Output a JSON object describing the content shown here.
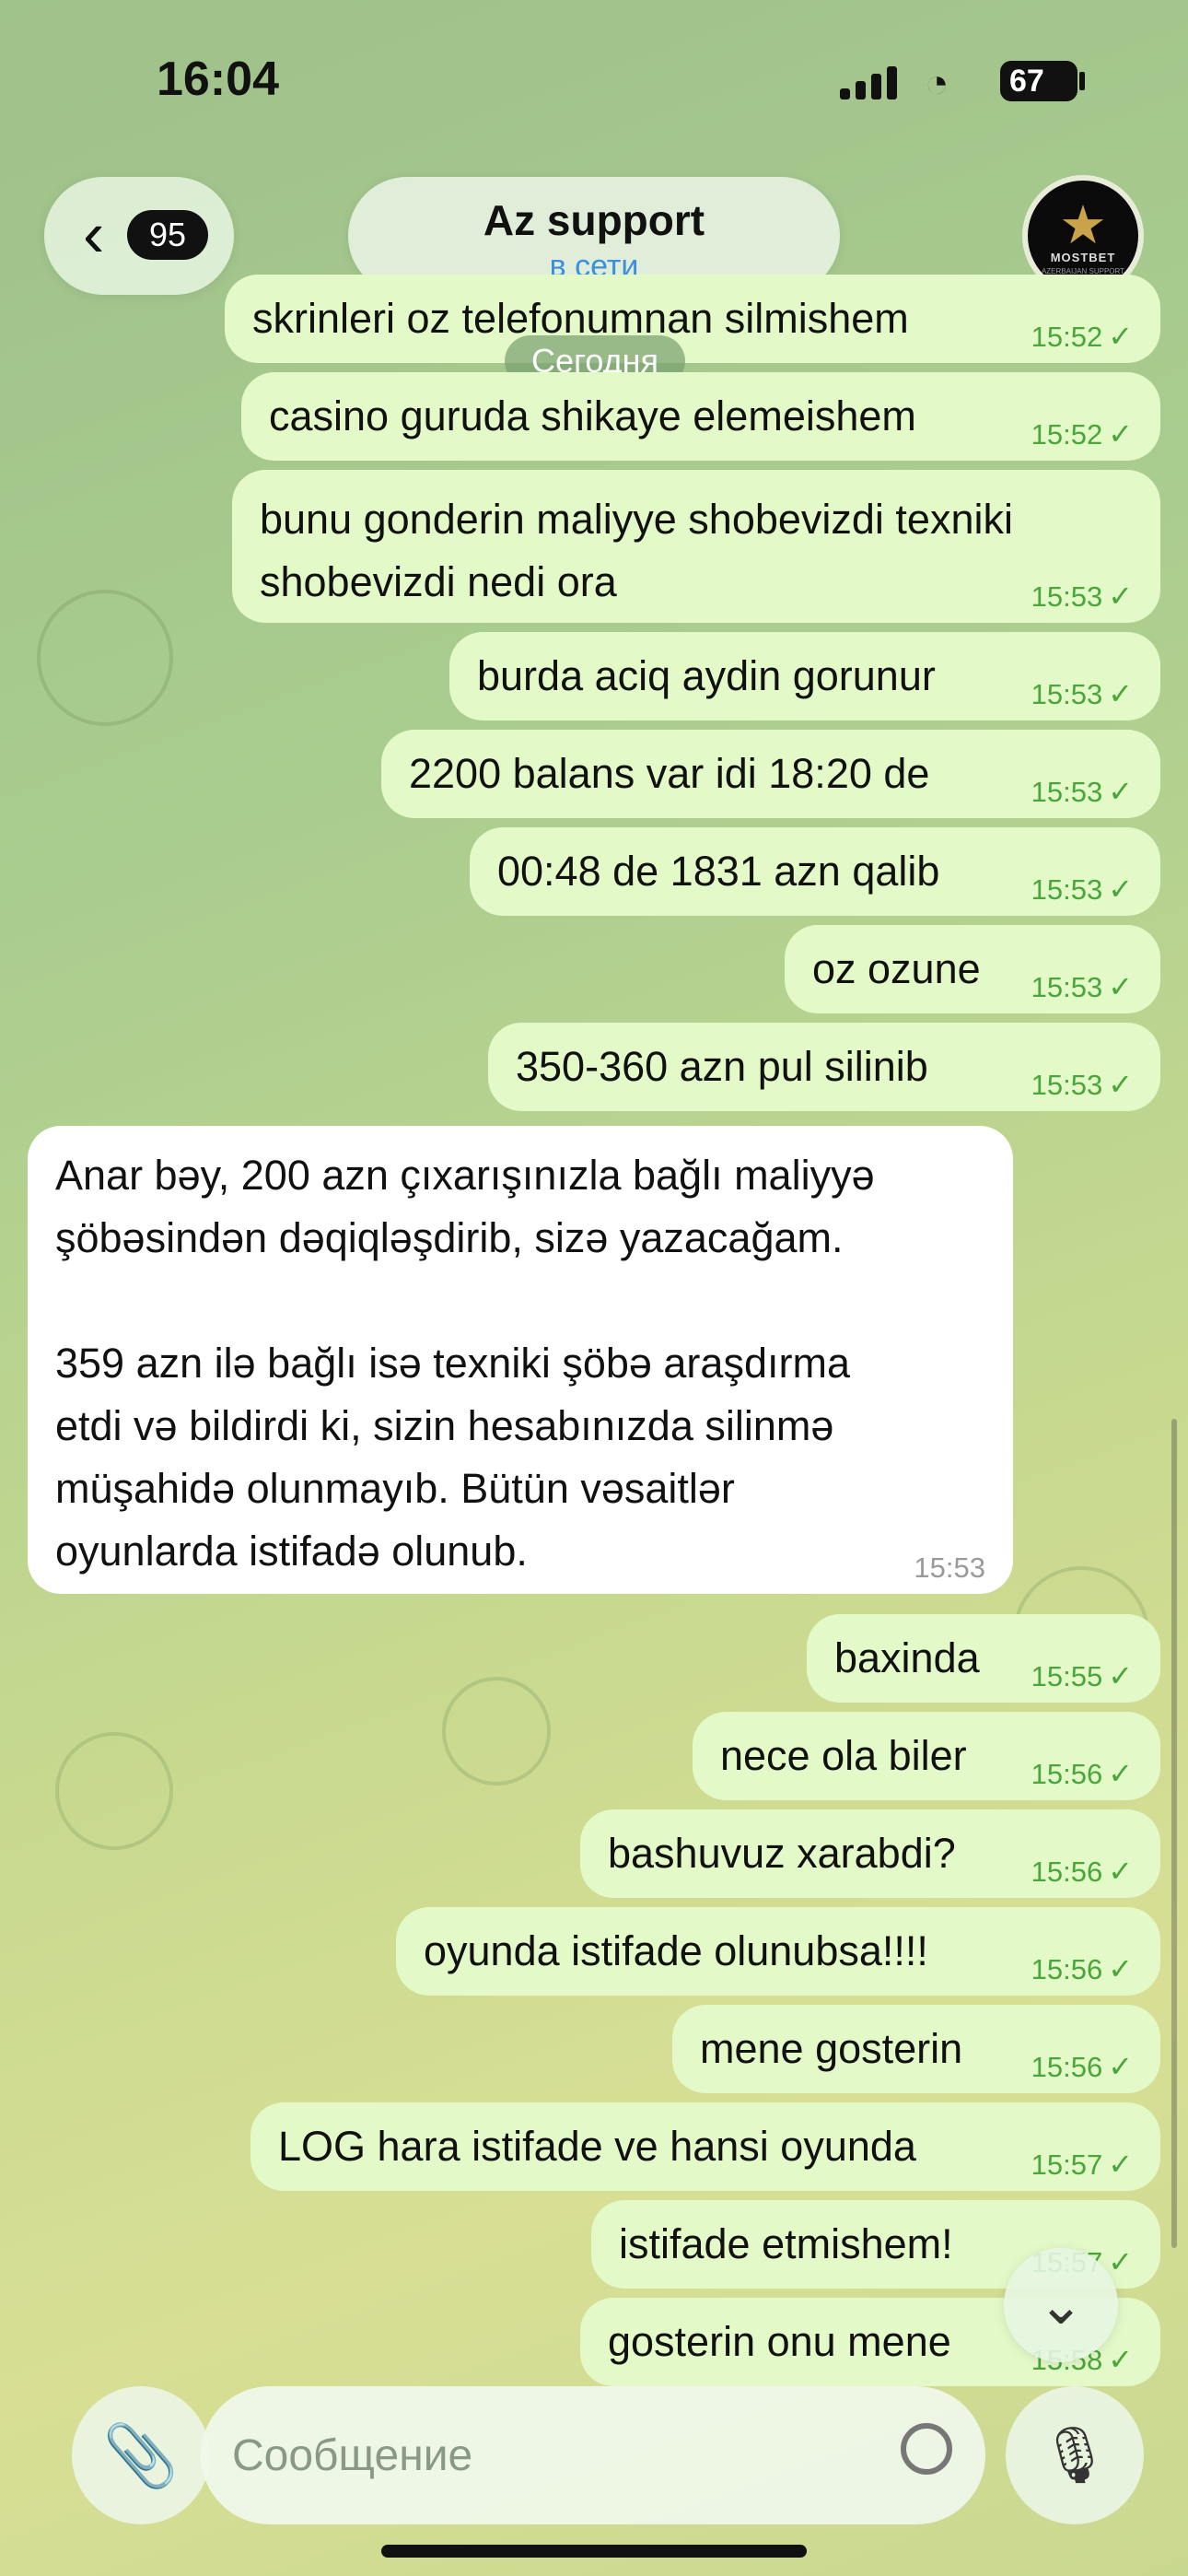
{
  "status_bar": {
    "time": "16:04",
    "battery": "67"
  },
  "header": {
    "back_count": "95",
    "chat_name": "Az support",
    "chat_status": "в сети",
    "avatar_text": "MOSTBET",
    "avatar_subtext": "AZERBAIJAN SUPPORT"
  },
  "date_chip": "Сегодня",
  "messages": [
    {
      "text": "skrinleri oz telefonumnan silmishem",
      "time": "15:52"
    },
    {
      "text": "casino guruda shikaye elemeishem",
      "time": "15:52"
    },
    {
      "line1": "bunu gonderin maliyye shobevizdi texniki",
      "line2": "shobevizdi nedi ora",
      "time": "15:53"
    },
    {
      "text": "burda aciq aydin gorunur",
      "time": "15:53"
    },
    {
      "text": "2200 balans var idi 18:20 de",
      "time": "15:53"
    },
    {
      "text": "00:48 de 1831 azn qalib",
      "time": "15:53"
    },
    {
      "text": "oz ozune",
      "time": "15:53"
    },
    {
      "text": "350-360 azn pul silinib",
      "time": "15:53"
    },
    {
      "incoming": true,
      "l1": "Anar bəy, 200 azn çıxarışınızla bağlı maliyyə",
      "l2": "şöbəsindən dəqiqləşdirib, sizə yazacağam.",
      "l3": "359 azn ilə bağlı isə texniki şöbə araşdırma",
      "l4": "etdi və bildirdi ki, sizin hesabınızda silinmə",
      "l5": "müşahidə olunmayıb. Bütün vəsaitlər",
      "l6": "oyunlarda istifadə olunub.",
      "time": "15:53"
    },
    {
      "text": "baxinda",
      "time": "15:55"
    },
    {
      "text": "nece ola biler",
      "time": "15:56"
    },
    {
      "text": "bashuvuz xarabdi?",
      "time": "15:56"
    },
    {
      "text": "oyunda istifade olunubsa!!!!",
      "time": "15:56"
    },
    {
      "text": "mene gosterin",
      "time": "15:56"
    },
    {
      "text": "LOG  hara istifade ve hansi oyunda",
      "time": "15:57"
    },
    {
      "text": "istifade etmishem!",
      "time": "15:57"
    },
    {
      "text": "gosterin onu mene",
      "time": "15:58"
    }
  ],
  "input": {
    "placeholder": "Сообщение"
  },
  "icons": {
    "back": "chevron-left-icon",
    "attach": "paperclip-icon",
    "sticker": "sticker-icon",
    "mic": "microphone-icon",
    "scroll_down": "chevron-down-icon"
  },
  "colors": {
    "outgoing_bubble": "#e3f9c8",
    "incoming_bubble": "#ffffff",
    "status_blue": "#3b8fe0",
    "check_green": "#4aa53a"
  }
}
